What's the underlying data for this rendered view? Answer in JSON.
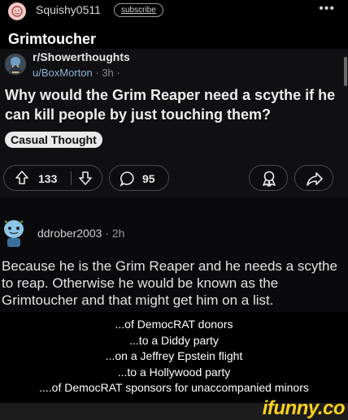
{
  "header": {
    "username": "Squishy0511",
    "subscribe_label": "subscribe",
    "more_label": "•••",
    "accent_color": "#f3c9c4"
  },
  "title": "Grimtoucher",
  "post": {
    "subreddit": "r/Showerthoughts",
    "user": "u/BoxMorton",
    "time": "· 3h ·",
    "title": "Why would the Grim Reaper need a scythe if he can kill people by just touching them?",
    "flair": "Casual Thought",
    "upvotes": "133",
    "comments": "95"
  },
  "comment": {
    "user": "ddrober2003",
    "time": "· 2h",
    "body": "Because he is the Grim Reaper and he needs a scythe to reap. Otherwise he would be known as the Grimtoucher and that might get him on a list."
  },
  "caption": [
    "...of DemocRAT donors",
    "...to a Diddy party",
    "...on a Jeffrey Epstein flight",
    "...to a Hollywood party",
    "....of DemocRAT sponsors for unaccompanied minors"
  ],
  "watermark": "ifunny.co",
  "icons": [
    "user-avatar-icon",
    "subreddit-avatar-icon",
    "upvote-icon",
    "downvote-icon",
    "comment-icon",
    "award-icon",
    "share-icon",
    "commenter-avatar-icon"
  ]
}
